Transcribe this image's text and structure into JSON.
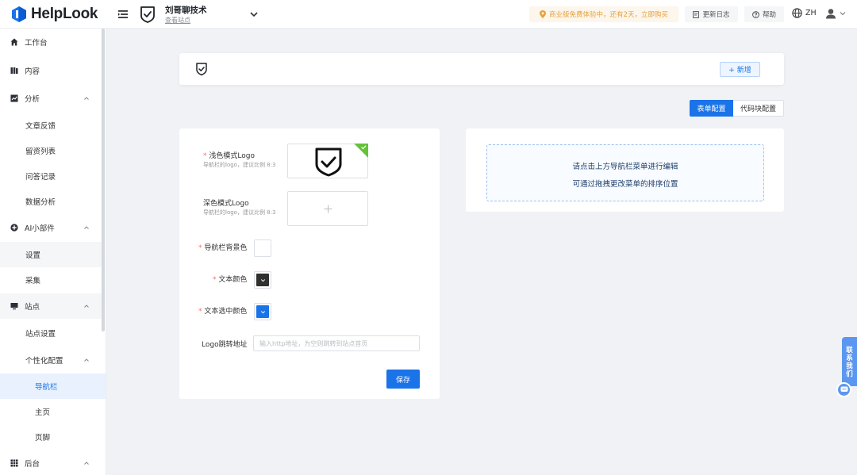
{
  "app": {
    "brand": "HelpLook"
  },
  "header": {
    "site_name": "刘哥聊技术",
    "site_link": "查看站点",
    "promo_text": "商业版免费体验中，还有2天，立即购买",
    "changelog_label": "更新日志",
    "help_label": "帮助",
    "lang_label": "ZH"
  },
  "sidebar": {
    "items": [
      {
        "label": "工作台",
        "icon": "home-icon"
      },
      {
        "label": "内容",
        "icon": "book-icon"
      },
      {
        "label": "分析",
        "icon": "chart-icon",
        "expanded": true
      },
      {
        "label": "文章反馈"
      },
      {
        "label": "留资列表"
      },
      {
        "label": "问答记录"
      },
      {
        "label": "数据分析"
      },
      {
        "label": "AI小部件",
        "icon": "plus-circle-icon",
        "expanded": true
      },
      {
        "label": "设置"
      },
      {
        "label": "采集"
      },
      {
        "label": "站点",
        "icon": "monitor-icon",
        "expanded": true
      },
      {
        "label": "站点设置"
      },
      {
        "label": "个性化配置",
        "expanded": true
      },
      {
        "label": "导航栏",
        "active": true
      },
      {
        "label": "主页"
      },
      {
        "label": "页脚"
      },
      {
        "label": "后台",
        "icon": "grid-icon",
        "expanded": true
      }
    ]
  },
  "toolbar": {
    "add_label": "+ 新增"
  },
  "tabs": {
    "form_config": "表单配置",
    "code_config": "代码块配置",
    "selected": "表单配置"
  },
  "form": {
    "required_mark": "*",
    "light_logo_label": "浅色模式Logo",
    "light_logo_hint": "导航栏的logo，建议比例 8:3",
    "dark_logo_label": "深色模式Logo",
    "dark_logo_hint": "导航栏的logo，建议比例 8:3",
    "bg_color_label": "导航栏背景色",
    "bg_color_value": "#ffffff",
    "text_color_label": "文本颜色",
    "text_color_value": "#303030",
    "selected_color_label": "文本选中颜色",
    "selected_color_value": "#1a73e8",
    "url_label": "Logo跳转地址",
    "url_value": "",
    "url_placeholder": "输入http地址，为空则跳转到站点首页",
    "save_label": "保存"
  },
  "preview": {
    "line1": "请点击上方导航栏菜单进行编辑",
    "line2": "可通过拖拽更改菜单的排序位置"
  },
  "contact": {
    "label": "联系我们"
  },
  "colors": {
    "primary": "#1a73e8",
    "promo": "#e6a23c",
    "required": "#f56c6c"
  }
}
